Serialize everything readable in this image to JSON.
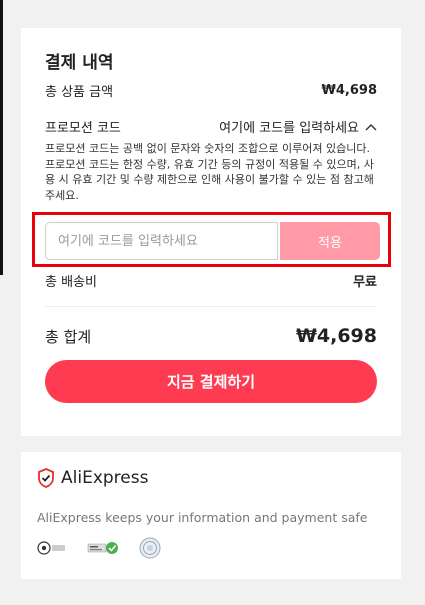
{
  "summary": {
    "title": "결제 내역",
    "subtotal_label": "총 상품 금액",
    "subtotal_value": "₩4,698",
    "promo_label": "프로모션 코드",
    "promo_toggle_label": "여기에 코드를 입력하세요",
    "promo_description": "프로모션 코드는 공백 없이 문자와 숫자의 조합으로 이루어져 있습니다. 프로모션 코드는 한정 수량, 유효 기간 등의 규정이 적용될 수 있으며, 사용 시 유효 기간 및 수량 제한으로 인해 사용이 불가할 수 있는 점 참고해 주세요.",
    "promo_input_placeholder": "여기에 코드를 입력하세요",
    "apply_label": "적용",
    "shipping_label": "총 배송비",
    "shipping_value": "무료",
    "total_label": "총 합계",
    "total_value": "₩4,698",
    "pay_button_label": "지금 결제하기"
  },
  "security": {
    "brand_name": "AliExpress",
    "message": "AliExpress keeps your information and payment safe",
    "badges": [
      "pci-dss-badge",
      "secure-payment-badge",
      "certification-seal-badge"
    ]
  },
  "colors": {
    "accent": "#ff3b52",
    "apply_disabled": "#ff9aa6",
    "highlight_border": "#e8000a"
  }
}
